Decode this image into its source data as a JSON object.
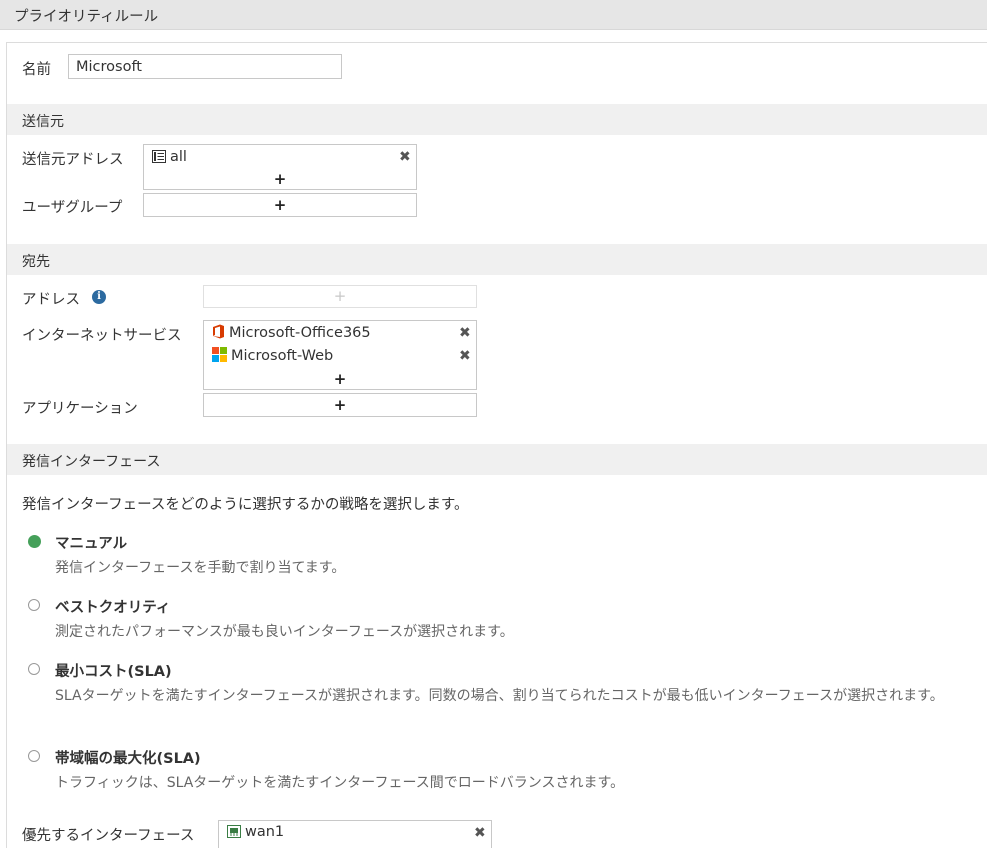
{
  "window": {
    "title": "プライオリティルール"
  },
  "name_field": {
    "label": "名前",
    "value": "Microsoft"
  },
  "source": {
    "header": "送信元",
    "address_label": "送信元アドレス",
    "address_entries": [
      {
        "label": "all",
        "icon": "address-icon"
      }
    ],
    "user_group_label": "ユーザグループ",
    "add_symbol": "+"
  },
  "destination": {
    "header": "宛先",
    "address_label": "アドレス",
    "internet_service_label": "インターネットサービス",
    "internet_services": [
      {
        "label": "Microsoft-Office365",
        "icon": "office365-icon",
        "icon_color": "#d83b01"
      },
      {
        "label": "Microsoft-Web",
        "icon": "microsoft-logo-icon"
      }
    ],
    "application_label": "アプリケーション",
    "add_symbol": "+"
  },
  "outgoing": {
    "header": "発信インターフェース",
    "description": "発信インターフェースをどのように選択するかの戦略を選択します。",
    "selected_color": "#45a05a",
    "options": [
      {
        "title": "マニュアル",
        "desc": "発信インターフェースを手動で割り当てます。",
        "selected": true
      },
      {
        "title": "ベストクオリティ",
        "desc": "測定されたパフォーマンスが最も良いインターフェースが選択されます。",
        "selected": false
      },
      {
        "title": "最小コスト(SLA)",
        "desc": "SLAターゲットを満たすインターフェースが選択されます。同数の場合、割り当てられたコストが最も低いインターフェースが選択されます。",
        "selected": false
      },
      {
        "title": "帯域幅の最大化(SLA)",
        "desc": "トラフィックは、SLAターゲットを満たすインターフェース間でロードバランスされます。",
        "selected": false
      }
    ],
    "preferred_label": "優先するインターフェース",
    "preferred_entries": [
      {
        "label": "wan1",
        "icon": "interface-port-icon"
      }
    ]
  }
}
